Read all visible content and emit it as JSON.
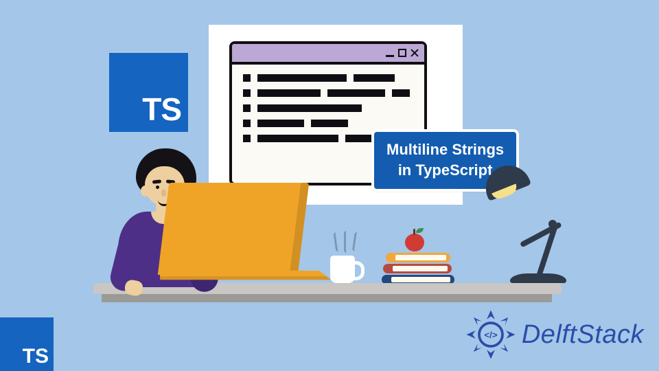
{
  "ts_label": "TS",
  "callout": {
    "line1": "Multiline Strings",
    "line2": "in TypeScript"
  },
  "window_controls": {
    "min": "_",
    "max": "□",
    "close": "×"
  },
  "brand": {
    "name": "DelftStack"
  },
  "code_lines": [
    {
      "bars": [
        130,
        60
      ]
    },
    {
      "bars": [
        92,
        84,
        26
      ]
    },
    {
      "bars": [
        152
      ]
    },
    {
      "bars": [
        68,
        54
      ]
    },
    {
      "bars": [
        118,
        44
      ]
    }
  ]
}
